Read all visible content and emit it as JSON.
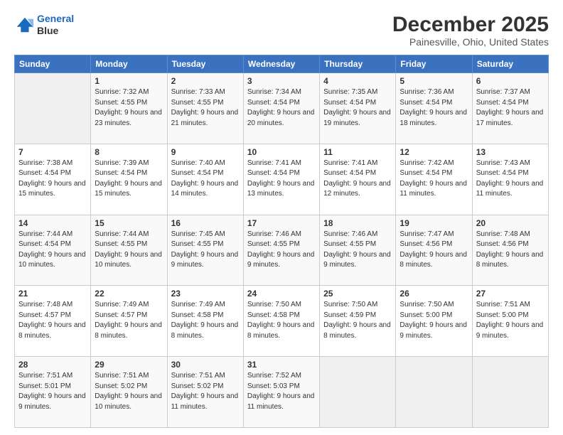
{
  "header": {
    "logo_line1": "General",
    "logo_line2": "Blue",
    "title": "December 2025",
    "subtitle": "Painesville, Ohio, United States"
  },
  "weekdays": [
    "Sunday",
    "Monday",
    "Tuesday",
    "Wednesday",
    "Thursday",
    "Friday",
    "Saturday"
  ],
  "weeks": [
    [
      {
        "day": "",
        "sunrise": "",
        "sunset": "",
        "daylight": ""
      },
      {
        "day": "1",
        "sunrise": "Sunrise: 7:32 AM",
        "sunset": "Sunset: 4:55 PM",
        "daylight": "Daylight: 9 hours and 23 minutes."
      },
      {
        "day": "2",
        "sunrise": "Sunrise: 7:33 AM",
        "sunset": "Sunset: 4:55 PM",
        "daylight": "Daylight: 9 hours and 21 minutes."
      },
      {
        "day": "3",
        "sunrise": "Sunrise: 7:34 AM",
        "sunset": "Sunset: 4:54 PM",
        "daylight": "Daylight: 9 hours and 20 minutes."
      },
      {
        "day": "4",
        "sunrise": "Sunrise: 7:35 AM",
        "sunset": "Sunset: 4:54 PM",
        "daylight": "Daylight: 9 hours and 19 minutes."
      },
      {
        "day": "5",
        "sunrise": "Sunrise: 7:36 AM",
        "sunset": "Sunset: 4:54 PM",
        "daylight": "Daylight: 9 hours and 18 minutes."
      },
      {
        "day": "6",
        "sunrise": "Sunrise: 7:37 AM",
        "sunset": "Sunset: 4:54 PM",
        "daylight": "Daylight: 9 hours and 17 minutes."
      }
    ],
    [
      {
        "day": "7",
        "sunrise": "Sunrise: 7:38 AM",
        "sunset": "Sunset: 4:54 PM",
        "daylight": "Daylight: 9 hours and 15 minutes."
      },
      {
        "day": "8",
        "sunrise": "Sunrise: 7:39 AM",
        "sunset": "Sunset: 4:54 PM",
        "daylight": "Daylight: 9 hours and 15 minutes."
      },
      {
        "day": "9",
        "sunrise": "Sunrise: 7:40 AM",
        "sunset": "Sunset: 4:54 PM",
        "daylight": "Daylight: 9 hours and 14 minutes."
      },
      {
        "day": "10",
        "sunrise": "Sunrise: 7:41 AM",
        "sunset": "Sunset: 4:54 PM",
        "daylight": "Daylight: 9 hours and 13 minutes."
      },
      {
        "day": "11",
        "sunrise": "Sunrise: 7:41 AM",
        "sunset": "Sunset: 4:54 PM",
        "daylight": "Daylight: 9 hours and 12 minutes."
      },
      {
        "day": "12",
        "sunrise": "Sunrise: 7:42 AM",
        "sunset": "Sunset: 4:54 PM",
        "daylight": "Daylight: 9 hours and 11 minutes."
      },
      {
        "day": "13",
        "sunrise": "Sunrise: 7:43 AM",
        "sunset": "Sunset: 4:54 PM",
        "daylight": "Daylight: 9 hours and 11 minutes."
      }
    ],
    [
      {
        "day": "14",
        "sunrise": "Sunrise: 7:44 AM",
        "sunset": "Sunset: 4:54 PM",
        "daylight": "Daylight: 9 hours and 10 minutes."
      },
      {
        "day": "15",
        "sunrise": "Sunrise: 7:44 AM",
        "sunset": "Sunset: 4:55 PM",
        "daylight": "Daylight: 9 hours and 10 minutes."
      },
      {
        "day": "16",
        "sunrise": "Sunrise: 7:45 AM",
        "sunset": "Sunset: 4:55 PM",
        "daylight": "Daylight: 9 hours and 9 minutes."
      },
      {
        "day": "17",
        "sunrise": "Sunrise: 7:46 AM",
        "sunset": "Sunset: 4:55 PM",
        "daylight": "Daylight: 9 hours and 9 minutes."
      },
      {
        "day": "18",
        "sunrise": "Sunrise: 7:46 AM",
        "sunset": "Sunset: 4:55 PM",
        "daylight": "Daylight: 9 hours and 9 minutes."
      },
      {
        "day": "19",
        "sunrise": "Sunrise: 7:47 AM",
        "sunset": "Sunset: 4:56 PM",
        "daylight": "Daylight: 9 hours and 8 minutes."
      },
      {
        "day": "20",
        "sunrise": "Sunrise: 7:48 AM",
        "sunset": "Sunset: 4:56 PM",
        "daylight": "Daylight: 9 hours and 8 minutes."
      }
    ],
    [
      {
        "day": "21",
        "sunrise": "Sunrise: 7:48 AM",
        "sunset": "Sunset: 4:57 PM",
        "daylight": "Daylight: 9 hours and 8 minutes."
      },
      {
        "day": "22",
        "sunrise": "Sunrise: 7:49 AM",
        "sunset": "Sunset: 4:57 PM",
        "daylight": "Daylight: 9 hours and 8 minutes."
      },
      {
        "day": "23",
        "sunrise": "Sunrise: 7:49 AM",
        "sunset": "Sunset: 4:58 PM",
        "daylight": "Daylight: 9 hours and 8 minutes."
      },
      {
        "day": "24",
        "sunrise": "Sunrise: 7:50 AM",
        "sunset": "Sunset: 4:58 PM",
        "daylight": "Daylight: 9 hours and 8 minutes."
      },
      {
        "day": "25",
        "sunrise": "Sunrise: 7:50 AM",
        "sunset": "Sunset: 4:59 PM",
        "daylight": "Daylight: 9 hours and 8 minutes."
      },
      {
        "day": "26",
        "sunrise": "Sunrise: 7:50 AM",
        "sunset": "Sunset: 5:00 PM",
        "daylight": "Daylight: 9 hours and 9 minutes."
      },
      {
        "day": "27",
        "sunrise": "Sunrise: 7:51 AM",
        "sunset": "Sunset: 5:00 PM",
        "daylight": "Daylight: 9 hours and 9 minutes."
      }
    ],
    [
      {
        "day": "28",
        "sunrise": "Sunrise: 7:51 AM",
        "sunset": "Sunset: 5:01 PM",
        "daylight": "Daylight: 9 hours and 9 minutes."
      },
      {
        "day": "29",
        "sunrise": "Sunrise: 7:51 AM",
        "sunset": "Sunset: 5:02 PM",
        "daylight": "Daylight: 9 hours and 10 minutes."
      },
      {
        "day": "30",
        "sunrise": "Sunrise: 7:51 AM",
        "sunset": "Sunset: 5:02 PM",
        "daylight": "Daylight: 9 hours and 11 minutes."
      },
      {
        "day": "31",
        "sunrise": "Sunrise: 7:52 AM",
        "sunset": "Sunset: 5:03 PM",
        "daylight": "Daylight: 9 hours and 11 minutes."
      },
      {
        "day": "",
        "sunrise": "",
        "sunset": "",
        "daylight": ""
      },
      {
        "day": "",
        "sunrise": "",
        "sunset": "",
        "daylight": ""
      },
      {
        "day": "",
        "sunrise": "",
        "sunset": "",
        "daylight": ""
      }
    ]
  ]
}
